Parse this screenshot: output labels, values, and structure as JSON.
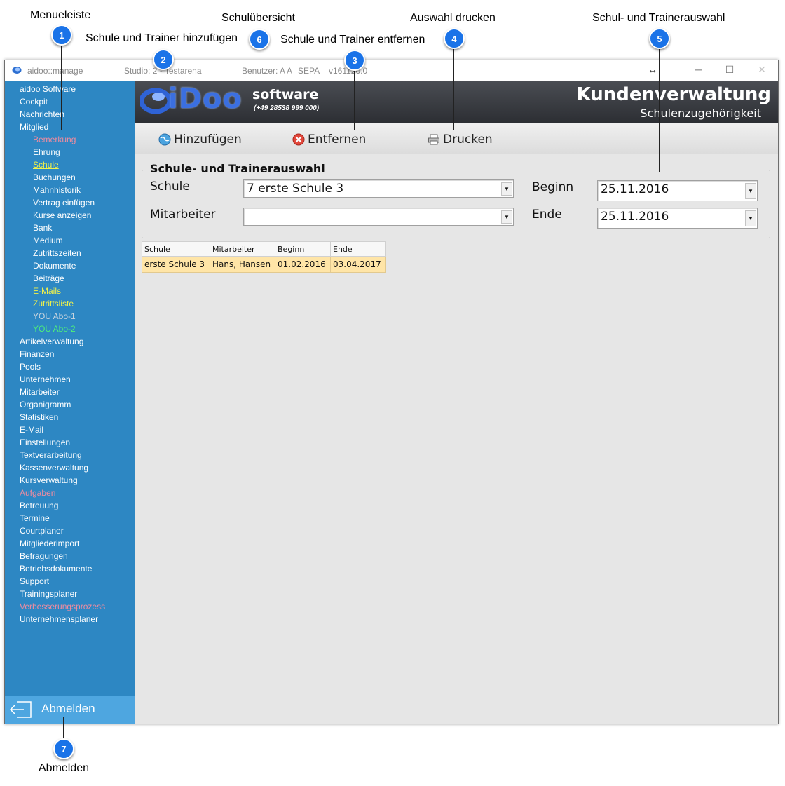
{
  "callouts": [
    {
      "num": "1",
      "label": "Menueleiste"
    },
    {
      "num": "2",
      "label": "Schule und Trainer hinzufügen"
    },
    {
      "num": "3",
      "label": "Schule und Trainer entfernen"
    },
    {
      "num": "4",
      "label": "Auswahl drucken"
    },
    {
      "num": "5",
      "label": "Schul- und Trainerauswahl"
    },
    {
      "num": "6",
      "label": "Schulübersicht"
    },
    {
      "num": "7",
      "label": "Abmelden"
    }
  ],
  "titlebar": {
    "app": "aidoo::manage",
    "studio": "Studio: 2 - Testarena",
    "user": "Benutzer: A A",
    "sepa": "SEPA",
    "version": "v161120.0"
  },
  "sidebar": {
    "items": [
      {
        "label": "aidoo Software",
        "level": 1
      },
      {
        "label": "Cockpit",
        "level": 1
      },
      {
        "label": "Nachrichten",
        "level": 1
      },
      {
        "label": "Mitglied",
        "level": 1
      },
      {
        "label": "Bemerkung",
        "level": 2,
        "style": "pink"
      },
      {
        "label": "Ehrung",
        "level": 2
      },
      {
        "label": "Schule",
        "level": 2,
        "style": "active"
      },
      {
        "label": "Buchungen",
        "level": 2
      },
      {
        "label": "Mahnhistorik",
        "level": 2
      },
      {
        "label": "Vertrag einfügen",
        "level": 2
      },
      {
        "label": "Kurse anzeigen",
        "level": 2
      },
      {
        "label": "Bank",
        "level": 2
      },
      {
        "label": "Medium",
        "level": 2
      },
      {
        "label": "Zutrittszeiten",
        "level": 2
      },
      {
        "label": "Dokumente",
        "level": 2
      },
      {
        "label": "Beiträge",
        "level": 2
      },
      {
        "label": "E-Mails",
        "level": 2,
        "style": "yellow"
      },
      {
        "label": "Zutrittsliste",
        "level": 2,
        "style": "yellow"
      },
      {
        "label": "YOU Abo-1",
        "level": 2,
        "style": "gray"
      },
      {
        "label": "YOU Abo-2",
        "level": 2,
        "style": "green"
      },
      {
        "label": "Artikelverwaltung",
        "level": 1
      },
      {
        "label": "Finanzen",
        "level": 1
      },
      {
        "label": "Pools",
        "level": 1
      },
      {
        "label": "Unternehmen",
        "level": 1
      },
      {
        "label": "Mitarbeiter",
        "level": 1
      },
      {
        "label": "Organigramm",
        "level": 1
      },
      {
        "label": "Statistiken",
        "level": 1
      },
      {
        "label": "E-Mail",
        "level": 1
      },
      {
        "label": "Einstellungen",
        "level": 1
      },
      {
        "label": "Textverarbeitung",
        "level": 1
      },
      {
        "label": "Kassenverwaltung",
        "level": 1
      },
      {
        "label": "Kursverwaltung",
        "level": 1
      },
      {
        "label": "Aufgaben",
        "level": 1,
        "style": "pink"
      },
      {
        "label": "Betreuung",
        "level": 1
      },
      {
        "label": "Termine",
        "level": 1
      },
      {
        "label": "Courtplaner",
        "level": 1
      },
      {
        "label": "Mitgliederimport",
        "level": 1
      },
      {
        "label": "Befragungen",
        "level": 1
      },
      {
        "label": "Betriebsdokumente",
        "level": 1
      },
      {
        "label": "Support",
        "level": 1
      },
      {
        "label": "Trainingsplaner",
        "level": 1
      },
      {
        "label": "Verbesserungsprozess",
        "level": 1,
        "style": "pink"
      },
      {
        "label": "Unternehmensplaner",
        "level": 1
      }
    ],
    "logout_label": "Abmelden"
  },
  "banner": {
    "logo_text": "iDoo",
    "logo_software": "software",
    "logo_phone": "(+49 28538 999 000)",
    "title": "Kundenverwaltung",
    "subtitle": "Schulenzugehörigkeit"
  },
  "toolbar": {
    "add_label": "Hinzufügen",
    "remove_label": "Entfernen",
    "print_label": "Drucken"
  },
  "form": {
    "group_title": "Schule- und Trainerauswahl",
    "school_label": "Schule",
    "school_value": "7 erste Schule 3",
    "staff_label": "Mitarbeiter",
    "staff_value": "",
    "begin_label": "Beginn",
    "begin_value": "25.11.2016",
    "end_label": "Ende",
    "end_value": "25.11.2016"
  },
  "grid": {
    "columns": [
      "Schule",
      "Mitarbeiter",
      "Beginn",
      "Ende"
    ],
    "rows": [
      [
        "erste Schule 3",
        "Hans, Hansen",
        "01.02.2016",
        "03.04.2017"
      ]
    ]
  },
  "colors": {
    "sidebar": "#2d87c3",
    "badge": "#1a73e8",
    "row_highlight": "#ffe5a7"
  }
}
